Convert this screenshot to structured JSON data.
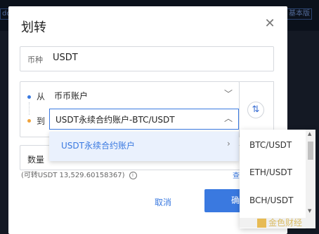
{
  "background": {
    "chips": [
      "ddd",
      "基本版"
    ]
  },
  "modal": {
    "title": "划转",
    "close_symbol": "✕",
    "coin": {
      "label": "币种",
      "value": "USDT"
    },
    "from": {
      "label": "从",
      "value": "币币账户"
    },
    "to": {
      "label": "到",
      "value": "USDT永续合约账户-BTC/USDT"
    },
    "quantity": {
      "label": "数量"
    },
    "available": "(可转USDT 13,529.60158367)",
    "partial_link": "查",
    "cancel_label": "取消",
    "confirm_label": "确"
  },
  "dropdown": {
    "category": "USDT永续合约账户",
    "options": [
      "BTC/USDT",
      "ETH/USDT",
      "BCH/USDT"
    ]
  },
  "watermark": "金色财经",
  "colors": {
    "accent": "#3a79e0",
    "orange": "#f0a23a"
  }
}
